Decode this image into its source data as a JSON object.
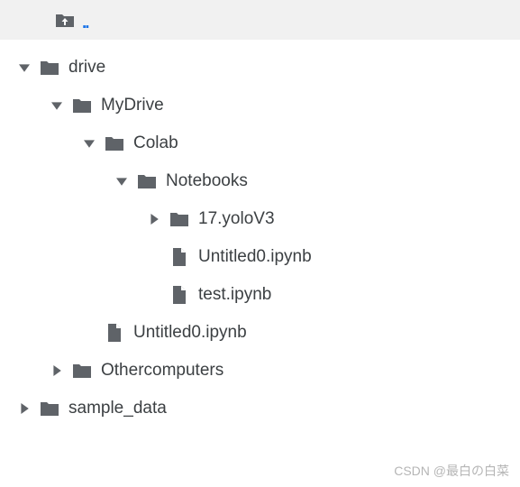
{
  "upload": {
    "parent_label": ".."
  },
  "tree": {
    "items": [
      {
        "label": "drive",
        "type": "folder",
        "expanded": true,
        "depth": 0
      },
      {
        "label": "MyDrive",
        "type": "folder",
        "expanded": true,
        "depth": 1
      },
      {
        "label": "Colab",
        "type": "folder",
        "expanded": true,
        "depth": 2
      },
      {
        "label": "Notebooks",
        "type": "folder",
        "expanded": true,
        "depth": 3
      },
      {
        "label": "17.yoloV3",
        "type": "folder",
        "expanded": false,
        "depth": 4
      },
      {
        "label": "Untitled0.ipynb",
        "type": "file",
        "depth": 4
      },
      {
        "label": "test.ipynb",
        "type": "file",
        "depth": 4
      },
      {
        "label": "Untitled0.ipynb",
        "type": "file",
        "depth": 2
      },
      {
        "label": "Othercomputers",
        "type": "folder",
        "expanded": false,
        "depth": 1
      },
      {
        "label": "sample_data",
        "type": "folder",
        "expanded": false,
        "depth": 0
      }
    ]
  },
  "watermark": "CSDN @最白の白菜",
  "colors": {
    "accent": "#1a73e8",
    "icon": "#5f6368",
    "text": "#3c4043",
    "bar_bg": "#f1f1f1"
  }
}
